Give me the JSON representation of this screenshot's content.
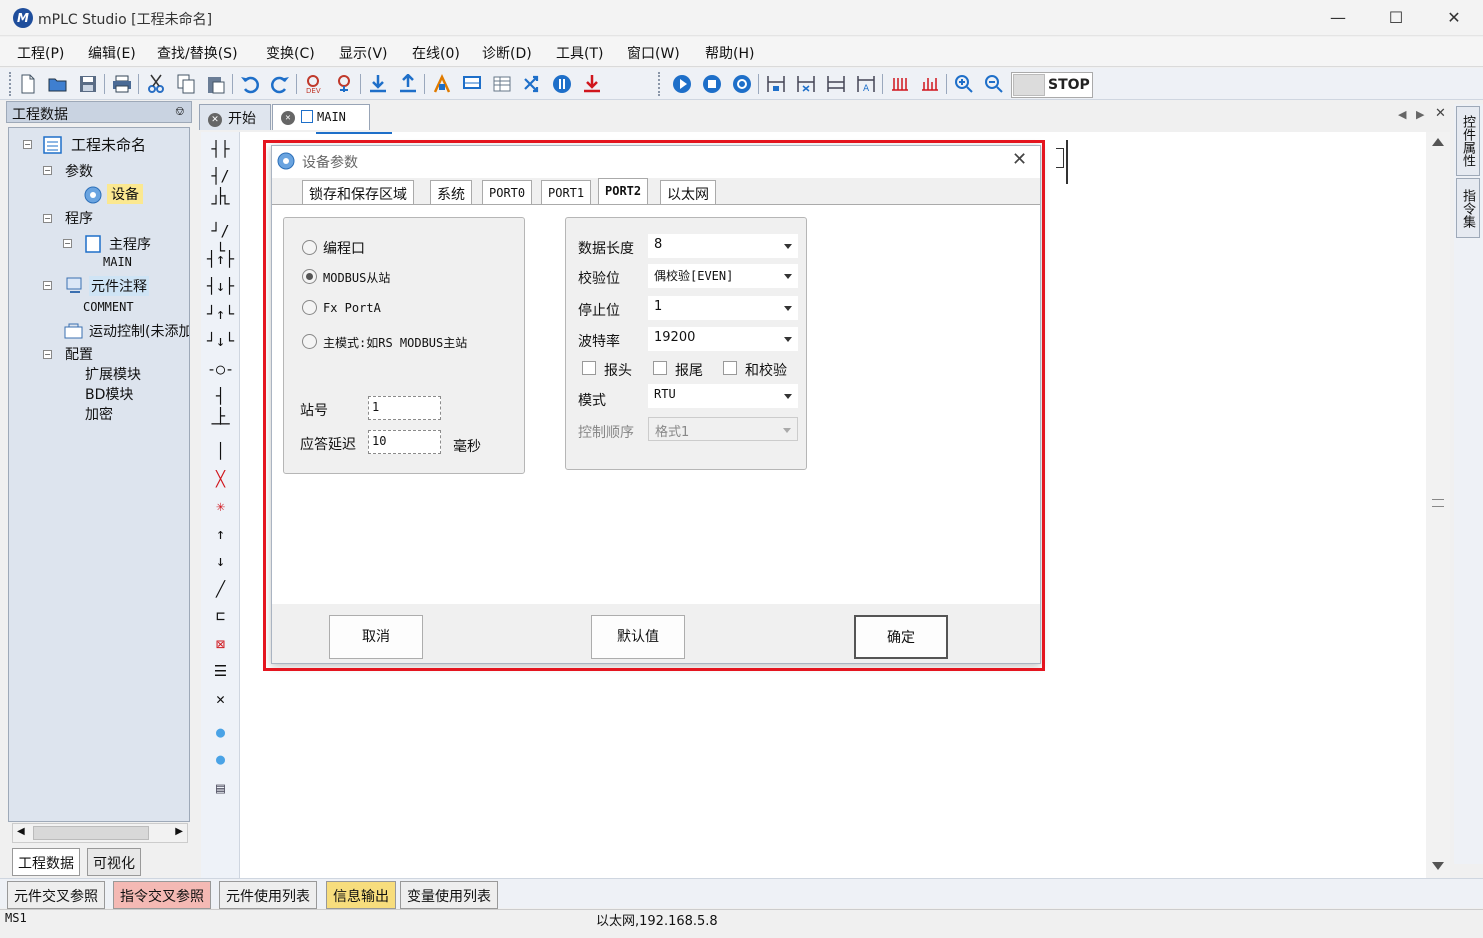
{
  "window": {
    "title": "mPLC Studio [工程未命名]",
    "logo": "M"
  },
  "menu": [
    "工程(P)",
    "编辑(E)",
    "查找/替换(S)",
    "变换(C)",
    "显示(V)",
    "在线(0)",
    "诊断(D)",
    "工具(T)",
    "窗口(W)",
    "帮助(H)"
  ],
  "toolbar": {
    "stop_label": "STOP"
  },
  "left_panel": {
    "title": "工程数据",
    "tree": {
      "root": "工程未命名",
      "params": "参数",
      "device": "设备",
      "program": "程序",
      "main_program": "主程序",
      "main": "MAIN",
      "comments": "元件注释",
      "comment": "COMMENT",
      "motion": "运动控制(未添加)",
      "config": "配置",
      "ext_module": "扩展模块",
      "bd_module": "BD模块",
      "encrypt": "加密"
    },
    "tabs": [
      "工程数据",
      "可视化"
    ]
  },
  "doc_tabs": {
    "start": "开始",
    "main": "MAIN"
  },
  "right_panel": {
    "tabs": [
      "控件属性",
      "指令集"
    ]
  },
  "bottom_tabs": [
    "元件交叉参照",
    "指令交叉参照",
    "元件使用列表",
    "信息输出",
    "变量使用列表"
  ],
  "status": {
    "left": "MS1",
    "center": "以太网,192.168.5.8"
  },
  "dialog": {
    "title": "设备参数",
    "tabs": [
      "锁存和保存区域",
      "系统",
      "PORT0",
      "PORT1",
      "PORT2",
      "以太网"
    ],
    "active_tab": "PORT2",
    "left_group": {
      "radios": [
        {
          "label": "编程口",
          "checked": false
        },
        {
          "label": "MODBUS从站",
          "checked": true
        },
        {
          "label": "Fx PortA",
          "checked": false
        },
        {
          "label": "主模式:如RS MODBUS主站",
          "checked": false
        }
      ],
      "station_label": "站号",
      "station_value": "1",
      "delay_label": "应答延迟",
      "delay_value": "10",
      "delay_unit": "毫秒"
    },
    "right_group": {
      "data_length_label": "数据长度",
      "data_length_value": "8",
      "parity_label": "校验位",
      "parity_value": "偶校验[EVEN]",
      "stop_bits_label": "停止位",
      "stop_bits_value": "1",
      "baud_label": "波特率",
      "baud_value": "19200",
      "header_label": "报头",
      "footer_label": "报尾",
      "checksum_label": "和校验",
      "mode_label": "模式",
      "mode_value": "RTU",
      "control_order_label": "控制顺序",
      "control_order_value": "格式1"
    },
    "buttons": {
      "cancel": "取消",
      "default": "默认值",
      "ok": "确定"
    }
  },
  "colors": {
    "highlight_border": "#e4151f",
    "tree_bg": "#dde4ee",
    "accent_blue": "#1e6fc9"
  }
}
